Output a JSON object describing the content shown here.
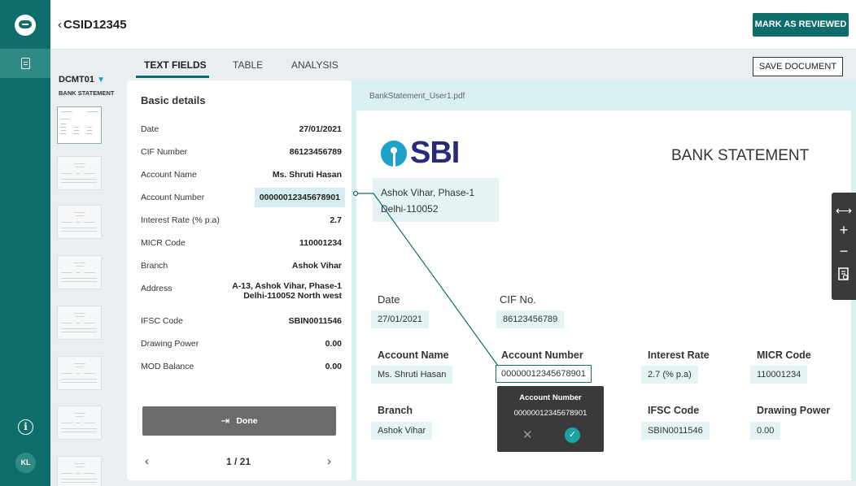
{
  "rail": {
    "user_initials": "KL"
  },
  "header": {
    "doc_id": "CSID12345",
    "back_icon": "chevron-left-icon",
    "mark_reviewed_label": "MARK AS REVIEWED"
  },
  "tabs": [
    {
      "label": "TEXT FIELDS",
      "active": true
    },
    {
      "label": "TABLE",
      "active": false
    },
    {
      "label": "ANALYSIS",
      "active": false
    }
  ],
  "save_document_label": "SAVE DOCUMENT",
  "thumbnails": {
    "doc_code": "DCMT01",
    "doc_type": "BANK STATEMENT"
  },
  "panel": {
    "title": "Basic details",
    "fields": [
      {
        "label": "Date",
        "value": "27/01/2021"
      },
      {
        "label": "CIF Number",
        "value": "86123456789"
      },
      {
        "label": "Account Name",
        "value": "Ms. Shruti Hasan"
      },
      {
        "label": "Account Number",
        "value": "00000012345678901"
      },
      {
        "label": "Interest Rate (% p.a)",
        "value": "2.7"
      },
      {
        "label": "MICR Code",
        "value": "110001234"
      },
      {
        "label": "Branch",
        "value": "Ashok Vihar"
      },
      {
        "label": "Address",
        "value_line1": "A-13, Ashok Vihar, Phase-1",
        "value_line2": "Delhi-110052 North west"
      },
      {
        "label": "IFSC Code",
        "value": "SBIN0011546"
      },
      {
        "label": "Drawing Power",
        "value": "0.00"
      },
      {
        "label": "MOD Balance",
        "value": "0.00"
      }
    ],
    "done_label": "Done",
    "pager": {
      "current_text": "1 / 21",
      "prev": "‹",
      "next": "›"
    }
  },
  "viewer": {
    "file_name": "BankStatement_User1.pdf",
    "logo_text": "SBI",
    "doc_title": "BANK STATEMENT",
    "address_line1": "Ashok Vihar, Phase-1",
    "address_line2": "Delhi-110052",
    "date_label": "Date",
    "date_value": "27/01/2021",
    "cif_label": "CIF No.",
    "cif_value": "86123456789",
    "acct_name_label": "Account Name",
    "acct_name_value": "Ms. Shruti Hasan",
    "acct_num_label": "Account Number",
    "acct_num_value": "00000012345678901",
    "interest_label": "Interest Rate",
    "interest_value": "2.7 (% p.a)",
    "micr_label": "MICR Code",
    "micr_value": "110001234",
    "branch_label": "Branch",
    "branch_value": "Ashok Vihar",
    "ifsc_label": "IFSC Code",
    "ifsc_value": "SBIN0011546",
    "drawing_label": "Drawing Power",
    "drawing_value": "0.00"
  },
  "tooltip": {
    "title": "Account Number",
    "value": "00000012345678901",
    "reject": "✕",
    "accept": "✓"
  },
  "zoom_tools": {
    "fit_width": "⟷",
    "zoom_in": "+",
    "zoom_out": "−"
  },
  "colors": {
    "accent": "#0f6e6b",
    "highlight": "#d6eef0",
    "logo_blue": "#1aa3c7"
  }
}
